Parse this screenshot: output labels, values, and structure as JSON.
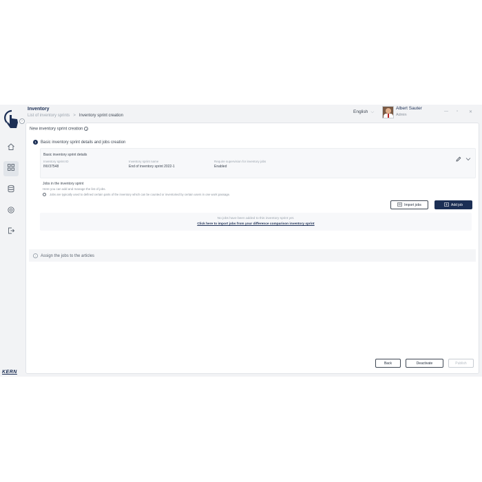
{
  "brand": {
    "accent": "#1c2f55",
    "footer_logo": "KERN"
  },
  "header": {
    "app_title": "Inventory",
    "breadcrumb": [
      "List of inventory sprints",
      "Inventory sprint creation"
    ],
    "language": "English",
    "user_name": "Albert Sauter",
    "user_role": "Admin"
  },
  "sidebar": {
    "items": [
      {
        "icon": "home-icon"
      },
      {
        "icon": "dashboard-grid-icon",
        "active": true
      },
      {
        "icon": "database-icon"
      },
      {
        "icon": "settings-icon"
      },
      {
        "icon": "logout-icon"
      }
    ]
  },
  "page": {
    "title": "New inventory sprint creation",
    "step1": {
      "number": "1",
      "title": "Basic inventory sprint details and jobs creation",
      "details": {
        "title": "Basic inventory sprint details",
        "fields": [
          {
            "label": "Inventory sprint ID",
            "value": "INV37548"
          },
          {
            "label": "Inventory sprint name",
            "value": "End of inventory sprint 2022-1"
          },
          {
            "label": "Require supervision for inventory jobs",
            "value": "Enabled"
          }
        ]
      },
      "jobs": {
        "title": "Jobs in the inventory sprint",
        "description": "Here you can add and manage the list of jobs.",
        "note": "Jobs are typically used to defined certain parts of the inventory which can be counted or inventoried by certain users in one work passage.",
        "import_button": "Import jobs",
        "add_button": "Add job",
        "empty_text": "No jobs have been added to this inventory sprint yet.",
        "empty_link": "Click here to import jobs from your difference comparison inventory sprint"
      }
    },
    "step2": {
      "title": "Assign the jobs to the articles"
    },
    "footer": {
      "back": "Back",
      "deactivate": "Deactivate",
      "publish": "Publish"
    }
  }
}
